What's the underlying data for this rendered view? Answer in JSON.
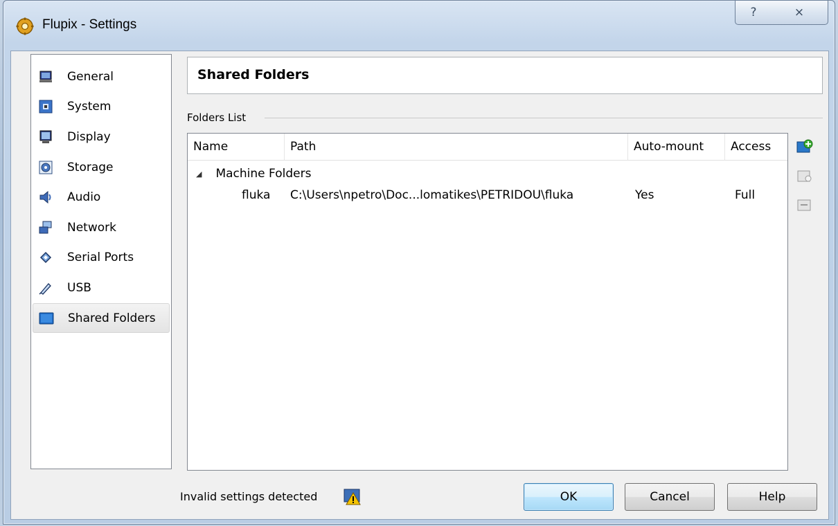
{
  "window": {
    "title": "Flupix - Settings",
    "help_glyph": "?",
    "close_glyph": "⨯"
  },
  "nav": {
    "items": [
      {
        "label": "General",
        "icon": "monitor-icon"
      },
      {
        "label": "System",
        "icon": "chip-icon"
      },
      {
        "label": "Display",
        "icon": "display-icon"
      },
      {
        "label": "Storage",
        "icon": "storage-icon"
      },
      {
        "label": "Audio",
        "icon": "speaker-icon"
      },
      {
        "label": "Network",
        "icon": "network-icon"
      },
      {
        "label": "Serial Ports",
        "icon": "serial-port-icon"
      },
      {
        "label": "USB",
        "icon": "usb-icon"
      },
      {
        "label": "Shared Folders",
        "icon": "folder-icon"
      }
    ],
    "selected": "Shared Folders"
  },
  "page": {
    "title": "Shared Folders",
    "group_label": "Folders List"
  },
  "table": {
    "columns": [
      "Name",
      "Path",
      "Auto-mount",
      "Access"
    ],
    "group": "Machine Folders",
    "rows": [
      {
        "name": "fluka",
        "path": "C:\\Users\\npetro\\Doc...lomatikes\\PETRIDOU\\fluka",
        "auto_mount": "Yes",
        "access": "Full"
      }
    ]
  },
  "tools": [
    "add-folder-icon",
    "edit-folder-icon",
    "remove-folder-icon"
  ],
  "footer": {
    "status": "Invalid settings detected",
    "ok": "OK",
    "cancel": "Cancel",
    "help": "Help"
  }
}
